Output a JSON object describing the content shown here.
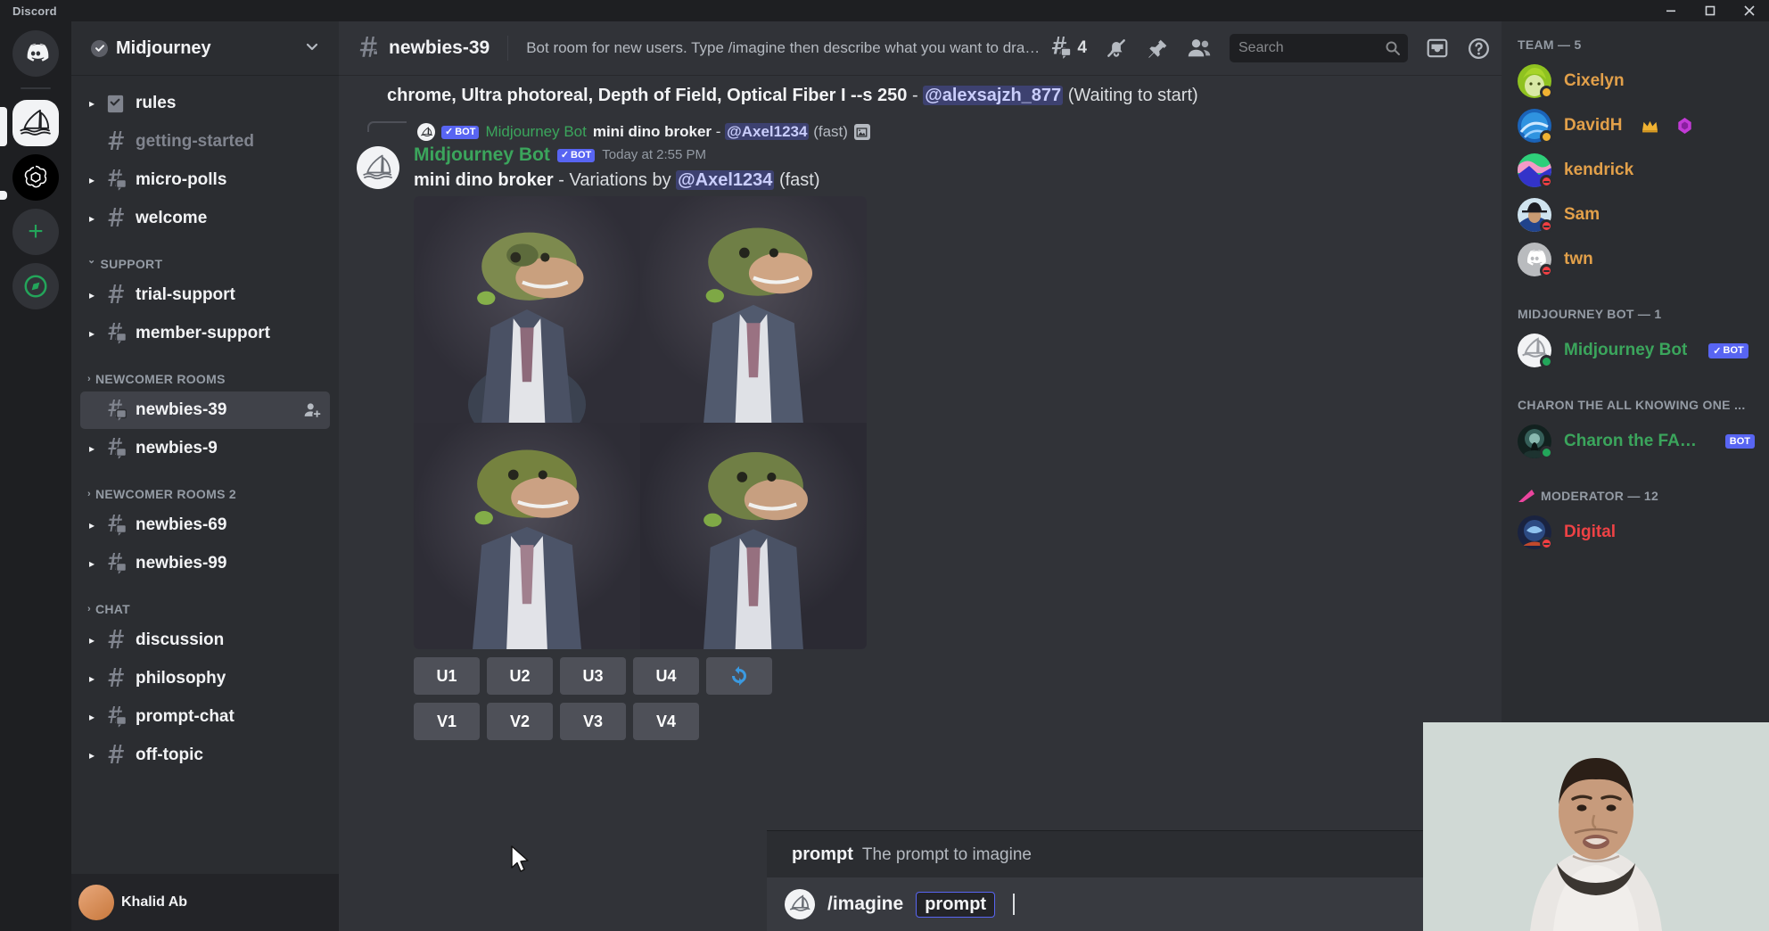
{
  "window": {
    "app_name": "Discord",
    "minimize": "minimize-icon",
    "maximize": "maximize-icon",
    "close": "close-icon"
  },
  "server_rail": {
    "items": [
      {
        "name": "discord-home",
        "label": "Discord"
      },
      {
        "name": "midjourney-server",
        "label": "Midjourney",
        "selected": true
      },
      {
        "name": "openai-server",
        "label": "OpenAI"
      },
      {
        "name": "add-server",
        "label": "Add a Server"
      },
      {
        "name": "explore-servers",
        "label": "Explore Public Servers"
      }
    ]
  },
  "guild": {
    "name": "Midjourney",
    "verified_icon": "verified-check-icon",
    "chevron": "chevron-down-icon"
  },
  "sidebar": {
    "entries": [
      {
        "type": "channel",
        "label": "rules",
        "icon": "rules-channel-icon",
        "muted": false,
        "arrow": true
      },
      {
        "type": "channel",
        "label": "getting-started",
        "icon": "hash-icon",
        "muted": true,
        "arrow": false
      },
      {
        "type": "channel",
        "label": "micro-polls",
        "icon": "hash-thread-icon",
        "muted": false,
        "arrow": true
      },
      {
        "type": "channel",
        "label": "welcome",
        "icon": "hash-icon",
        "muted": false,
        "arrow": true
      },
      {
        "type": "category",
        "label": "SUPPORT",
        "expanded": true
      },
      {
        "type": "channel",
        "label": "trial-support",
        "icon": "hash-icon",
        "muted": false,
        "arrow": true
      },
      {
        "type": "channel",
        "label": "member-support",
        "icon": "hash-thread-icon",
        "muted": false,
        "arrow": true
      },
      {
        "type": "category",
        "label": "NEWCOMER ROOMS",
        "expanded": false
      },
      {
        "type": "channel",
        "label": "newbies-39",
        "icon": "hash-thread-icon",
        "muted": false,
        "arrow": false,
        "active": true,
        "trailing_icon": "add-member-icon"
      },
      {
        "type": "channel",
        "label": "newbies-9",
        "icon": "hash-thread-icon",
        "muted": false,
        "arrow": true
      },
      {
        "type": "category",
        "label": "NEWCOMER ROOMS 2",
        "expanded": false
      },
      {
        "type": "channel",
        "label": "newbies-69",
        "icon": "hash-thread-icon",
        "muted": false,
        "arrow": true
      },
      {
        "type": "channel",
        "label": "newbies-99",
        "icon": "hash-thread-icon",
        "muted": false,
        "arrow": true
      },
      {
        "type": "category",
        "label": "CHAT",
        "expanded": false
      },
      {
        "type": "channel",
        "label": "discussion",
        "icon": "hash-icon",
        "muted": false,
        "arrow": true
      },
      {
        "type": "channel",
        "label": "philosophy",
        "icon": "hash-icon",
        "muted": false,
        "arrow": true
      },
      {
        "type": "channel",
        "label": "prompt-chat",
        "icon": "hash-thread-icon",
        "muted": false,
        "arrow": true
      },
      {
        "type": "channel",
        "label": "off-topic",
        "icon": "hash-icon",
        "muted": false,
        "arrow": true
      }
    ],
    "user_panel": {
      "username": "Khalid Ab"
    }
  },
  "channel_header": {
    "icon": "hash-locked-icon",
    "title": "newbies-39",
    "topic": "Bot room for new users. Type /imagine then describe what you want to draw....",
    "threads_icon": "threads-icon",
    "threads_count": "4",
    "notifications_icon": "bell-muted-icon",
    "pin_icon": "pin-icon",
    "members_icon": "members-icon",
    "inbox_icon": "inbox-icon",
    "help_icon": "help-icon"
  },
  "search": {
    "placeholder": "Search",
    "icon": "search-icon"
  },
  "messages": {
    "previous_tail": {
      "text": "chrome, Ultra photoreal, Depth of Field, Optical Fiber I --s 250",
      "separator": " - ",
      "mention": "@alexsajzh_877",
      "suffix": " (Waiting to start)"
    },
    "reply_reference": {
      "bot_tag": "BOT",
      "check": "✓",
      "author": "Midjourney Bot",
      "prompt": "mini dino broker",
      "dash": " - ",
      "mention": "@Axel1234",
      "speed": "(fast)",
      "attachment_icon": "image-attachment-icon"
    },
    "main": {
      "author": "Midjourney Bot",
      "bot_tag": "BOT",
      "check": "✓",
      "timestamp": "Today at 2:55 PM",
      "prompt": "mini dino broker",
      "dash": " - ",
      "variation_label": "Variations by ",
      "mention": "@Axel1234",
      "speed": "(fast)",
      "grid_alt": "2x2 grid of dinosaur-in-a-suit images"
    },
    "upscale_buttons": [
      "U1",
      "U2",
      "U3",
      "U4"
    ],
    "reroll_button": {
      "name": "reroll-button",
      "icon": "refresh-icon"
    },
    "variation_buttons": [
      "V1",
      "V2",
      "V3",
      "V4"
    ]
  },
  "command_popup": {
    "arg_name": "prompt",
    "arg_description": "The prompt to imagine"
  },
  "composer": {
    "command": "/imagine",
    "arg_pill": "prompt",
    "emoji_icon": "emoji-icon"
  },
  "members_panel": {
    "groups": [
      {
        "label": "TEAM — 5",
        "icon": null,
        "members": [
          {
            "name": "Cixelyn",
            "color": "#e2a04a",
            "status": "idle",
            "avatar": "green-hair-avatar",
            "badges": []
          },
          {
            "name": "DavidH",
            "color": "#e2a04a",
            "status": "idle",
            "avatar": "blue-swirl-avatar",
            "badges": [
              "crown-icon",
              "gem-icon"
            ]
          },
          {
            "name": "kendrick",
            "color": "#e2a04a",
            "status": "dnd",
            "avatar": "landscape-avatar",
            "badges": []
          },
          {
            "name": "Sam",
            "color": "#e2a04a",
            "status": "dnd",
            "avatar": "hat-person-avatar",
            "badges": []
          },
          {
            "name": "twn",
            "color": "#e2a04a",
            "status": "dnd",
            "avatar": "discord-default-avatar",
            "badges": []
          }
        ]
      },
      {
        "label": "MIDJOURNEY BOT — 1",
        "icon": null,
        "members": [
          {
            "name": "Midjourney Bot",
            "color": "#3ba55c",
            "status": "online",
            "avatar": "midjourney-sailboat-avatar",
            "badges": [
              "verified-bot-tag"
            ],
            "bot_tag": "BOT",
            "bot_check": "✓"
          }
        ]
      },
      {
        "label": "CHARON THE ALL KNOWING ONE ...",
        "icon": null,
        "members": [
          {
            "name": "Charon the FAQ ...",
            "color": "#3ba55c",
            "status": "online",
            "avatar": "charon-avatar",
            "badges": [
              "bot-tag"
            ],
            "bot_tag": "BOT"
          }
        ]
      },
      {
        "label": "MODERATOR — 12",
        "icon": "moderator-hat-icon",
        "members": [
          {
            "name": "Digital",
            "color": "#ed4245",
            "status": "dnd",
            "avatar": "blue-helmet-avatar",
            "badges": []
          }
        ]
      }
    ]
  },
  "webcam_overlay": {
    "label": "webcam-video-overlay"
  },
  "colors": {
    "brand": "#5865f2",
    "online": "#23a55a",
    "idle": "#f0b232",
    "dnd": "#f23f43",
    "bot_green": "#3ba55c",
    "sidebar_bg": "#2b2d31",
    "main_bg": "#313338",
    "rail_bg": "#1e1f22"
  }
}
